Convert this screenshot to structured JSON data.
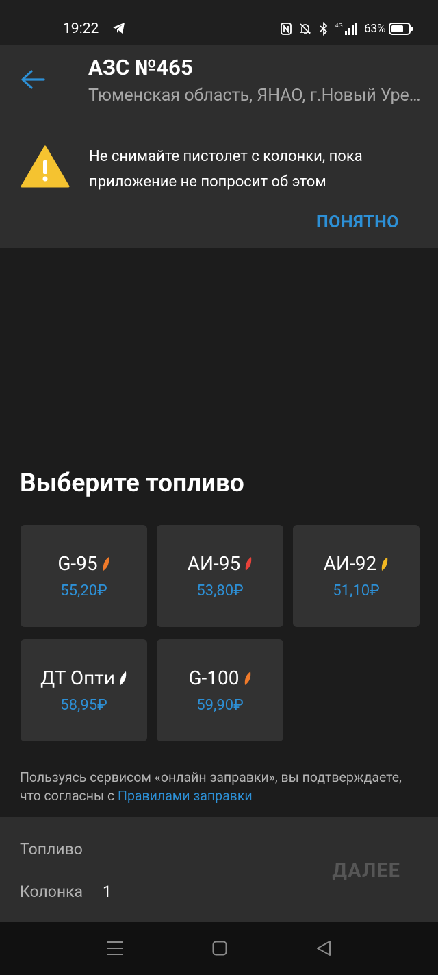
{
  "status_bar": {
    "time": "19:22",
    "battery_percent": "63%",
    "network": "4G"
  },
  "header": {
    "title": "АЗС №465",
    "subtitle": "Тюменская область, ЯНАО, г.Новый Уренгой"
  },
  "warning": {
    "text": "Не снимайте пистолет с колонки, пока приложение не попросит об этом",
    "ok_label": "ПОНЯТНО"
  },
  "fuel": {
    "title": "Выберите топливо",
    "items": [
      {
        "name": "G-95",
        "price": "55,20₽",
        "leaf_color": "#f07a2a"
      },
      {
        "name": "АИ-95",
        "price": "53,80₽",
        "leaf_color": "#e8423a"
      },
      {
        "name": "АИ-92",
        "price": "51,10₽",
        "leaf_color": "#f2b822"
      },
      {
        "name": "ДТ Опти",
        "price": "58,95₽",
        "leaf_color": "#ffffff"
      },
      {
        "name": "G-100",
        "price": "59,90₽",
        "leaf_color": "#f07a2a"
      }
    ]
  },
  "terms": {
    "text": "Пользуясь сервисом «онлайн заправки», вы подтверждаете, что согласны с ",
    "link": "Правилами заправки"
  },
  "summary": {
    "fuel_label": "Топливо",
    "column_label": "Колонка",
    "column_value": "1",
    "next_label": "ДАЛЕЕ"
  },
  "colors": {
    "accent": "#2d90d6",
    "background": "#1c1c1c",
    "panel": "#2e2e2e",
    "card": "#323232",
    "warning": "#f5c330"
  }
}
